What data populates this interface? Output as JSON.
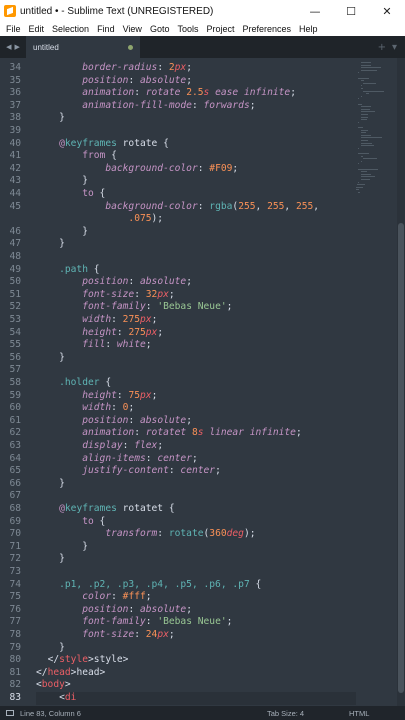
{
  "window": {
    "title": "untitled • - Sublime Text (UNREGISTERED)",
    "minimize_glyph": "—",
    "maximize_glyph": "☐",
    "close_glyph": "✕"
  },
  "menu": [
    "File",
    "Edit",
    "Selection",
    "Find",
    "View",
    "Goto",
    "Tools",
    "Project",
    "Preferences",
    "Help"
  ],
  "tab": {
    "label": "untitled",
    "nav_left": "◀",
    "nav_right": "▶",
    "add": "+",
    "dropdown": "▾"
  },
  "status": {
    "position": "Line 83, Column 6",
    "tab_size": "Tab Size: 4",
    "syntax": "HTML"
  },
  "colors": {
    "bg": "#303841",
    "tabbar": "#1f2429",
    "status": "#20252b",
    "accent": "#8ea56e"
  },
  "active_line": 83,
  "code": [
    {
      "n": 34,
      "i": 8,
      "t": [
        [
          "prop",
          "border-radius"
        ],
        [
          "punct",
          ": "
        ],
        [
          "num",
          "2"
        ],
        [
          "unit",
          "px"
        ],
        [
          "punct",
          ";"
        ]
      ]
    },
    {
      "n": 35,
      "i": 8,
      "t": [
        [
          "prop",
          "position"
        ],
        [
          "punct",
          ": "
        ],
        [
          "val",
          "absolute"
        ],
        [
          "punct",
          ";"
        ]
      ]
    },
    {
      "n": 36,
      "i": 8,
      "t": [
        [
          "prop",
          "animation"
        ],
        [
          "punct",
          ": "
        ],
        [
          "val",
          "rotate "
        ],
        [
          "num",
          "2.5"
        ],
        [
          "unit",
          "s"
        ],
        [
          "val",
          " ease infinite"
        ],
        [
          "punct",
          ";"
        ]
      ]
    },
    {
      "n": 37,
      "i": 8,
      "t": [
        [
          "prop",
          "animation-fill-mode"
        ],
        [
          "punct",
          ": "
        ],
        [
          "val",
          "forwards"
        ],
        [
          "punct",
          ";"
        ]
      ]
    },
    {
      "n": 38,
      "i": 4,
      "t": [
        [
          "punct",
          "}"
        ]
      ]
    },
    {
      "n": 39,
      "i": 0,
      "t": []
    },
    {
      "n": 40,
      "i": 4,
      "t": [
        [
          "at",
          "@"
        ],
        [
          "kw",
          "keyframes"
        ],
        [
          "txt",
          " rotate "
        ],
        [
          "punct",
          "{"
        ]
      ]
    },
    {
      "n": 41,
      "i": 8,
      "t": [
        [
          "at",
          "from"
        ],
        [
          "punct",
          " {"
        ]
      ]
    },
    {
      "n": 42,
      "i": 12,
      "t": [
        [
          "prop",
          "background-color"
        ],
        [
          "punct",
          ": "
        ],
        [
          "hex",
          "#F09"
        ],
        [
          "punct",
          ";"
        ]
      ]
    },
    {
      "n": 43,
      "i": 8,
      "t": [
        [
          "punct",
          "}"
        ]
      ]
    },
    {
      "n": 44,
      "i": 8,
      "t": [
        [
          "at",
          "to"
        ],
        [
          "punct",
          " {"
        ]
      ]
    },
    {
      "n": 45,
      "i": 12,
      "t": [
        [
          "prop",
          "background-color"
        ],
        [
          "punct",
          ": "
        ],
        [
          "fn",
          "rgba"
        ],
        [
          "punct",
          "("
        ],
        [
          "num",
          "255"
        ],
        [
          "punct",
          ", "
        ],
        [
          "num",
          "255"
        ],
        [
          "punct",
          ", "
        ],
        [
          "num",
          "255"
        ],
        [
          "punct",
          ","
        ]
      ]
    },
    {
      "n": null,
      "i": 16,
      "t": [
        [
          "num",
          ".075"
        ],
        [
          "punct",
          ");"
        ]
      ]
    },
    {
      "n": 46,
      "i": 8,
      "t": [
        [
          "punct",
          "}"
        ]
      ]
    },
    {
      "n": 47,
      "i": 4,
      "t": [
        [
          "punct",
          "}"
        ]
      ]
    },
    {
      "n": 48,
      "i": 0,
      "t": []
    },
    {
      "n": 49,
      "i": 4,
      "t": [
        [
          "sel",
          ".path"
        ],
        [
          "punct",
          " {"
        ]
      ]
    },
    {
      "n": 50,
      "i": 8,
      "t": [
        [
          "prop",
          "position"
        ],
        [
          "punct",
          ": "
        ],
        [
          "val",
          "absolute"
        ],
        [
          "punct",
          ";"
        ]
      ]
    },
    {
      "n": 51,
      "i": 8,
      "t": [
        [
          "prop",
          "font-size"
        ],
        [
          "punct",
          ": "
        ],
        [
          "num",
          "32"
        ],
        [
          "unit",
          "px"
        ],
        [
          "punct",
          ";"
        ]
      ]
    },
    {
      "n": 52,
      "i": 8,
      "t": [
        [
          "prop",
          "font-family"
        ],
        [
          "punct",
          ": "
        ],
        [
          "str",
          "'Bebas Neue'"
        ],
        [
          "punct",
          ";"
        ]
      ]
    },
    {
      "n": 53,
      "i": 8,
      "t": [
        [
          "prop",
          "width"
        ],
        [
          "punct",
          ": "
        ],
        [
          "num",
          "275"
        ],
        [
          "unit",
          "px"
        ],
        [
          "punct",
          ";"
        ]
      ]
    },
    {
      "n": 54,
      "i": 8,
      "t": [
        [
          "prop",
          "height"
        ],
        [
          "punct",
          ": "
        ],
        [
          "num",
          "275"
        ],
        [
          "unit",
          "px"
        ],
        [
          "punct",
          ";"
        ]
      ]
    },
    {
      "n": 55,
      "i": 8,
      "t": [
        [
          "prop",
          "fill"
        ],
        [
          "punct",
          ": "
        ],
        [
          "val",
          "white"
        ],
        [
          "punct",
          ";"
        ]
      ]
    },
    {
      "n": 56,
      "i": 4,
      "t": [
        [
          "punct",
          "}"
        ]
      ]
    },
    {
      "n": 57,
      "i": 0,
      "t": []
    },
    {
      "n": 58,
      "i": 4,
      "t": [
        [
          "sel",
          ".holder"
        ],
        [
          "punct",
          " {"
        ]
      ]
    },
    {
      "n": 59,
      "i": 8,
      "t": [
        [
          "prop",
          "height"
        ],
        [
          "punct",
          ": "
        ],
        [
          "num",
          "75"
        ],
        [
          "unit",
          "px"
        ],
        [
          "punct",
          ";"
        ]
      ]
    },
    {
      "n": 60,
      "i": 8,
      "t": [
        [
          "prop",
          "width"
        ],
        [
          "punct",
          ": "
        ],
        [
          "num",
          "0"
        ],
        [
          "punct",
          ";"
        ]
      ]
    },
    {
      "n": 61,
      "i": 8,
      "t": [
        [
          "prop",
          "position"
        ],
        [
          "punct",
          ": "
        ],
        [
          "val",
          "absolute"
        ],
        [
          "punct",
          ";"
        ]
      ]
    },
    {
      "n": 62,
      "i": 8,
      "t": [
        [
          "prop",
          "animation"
        ],
        [
          "punct",
          ": "
        ],
        [
          "val",
          "rotatet "
        ],
        [
          "num",
          "8"
        ],
        [
          "unit",
          "s"
        ],
        [
          "val",
          " linear infinite"
        ],
        [
          "punct",
          ";"
        ]
      ]
    },
    {
      "n": 63,
      "i": 8,
      "t": [
        [
          "prop",
          "display"
        ],
        [
          "punct",
          ": "
        ],
        [
          "val",
          "flex"
        ],
        [
          "punct",
          ";"
        ]
      ]
    },
    {
      "n": 64,
      "i": 8,
      "t": [
        [
          "prop",
          "align-items"
        ],
        [
          "punct",
          ": "
        ],
        [
          "val",
          "center"
        ],
        [
          "punct",
          ";"
        ]
      ]
    },
    {
      "n": 65,
      "i": 8,
      "t": [
        [
          "prop",
          "justify-content"
        ],
        [
          "punct",
          ": "
        ],
        [
          "val",
          "center"
        ],
        [
          "punct",
          ";"
        ]
      ]
    },
    {
      "n": 66,
      "i": 4,
      "t": [
        [
          "punct",
          "}"
        ]
      ]
    },
    {
      "n": 67,
      "i": 0,
      "t": []
    },
    {
      "n": 68,
      "i": 4,
      "t": [
        [
          "at",
          "@"
        ],
        [
          "kw",
          "keyframes"
        ],
        [
          "txt",
          " rotatet "
        ],
        [
          "punct",
          "{"
        ]
      ]
    },
    {
      "n": 69,
      "i": 8,
      "t": [
        [
          "at",
          "to"
        ],
        [
          "punct",
          " {"
        ]
      ]
    },
    {
      "n": 70,
      "i": 12,
      "t": [
        [
          "prop",
          "transform"
        ],
        [
          "punct",
          ": "
        ],
        [
          "fn",
          "rotate"
        ],
        [
          "punct",
          "("
        ],
        [
          "num",
          "360"
        ],
        [
          "unit",
          "deg"
        ],
        [
          "punct",
          ");"
        ]
      ]
    },
    {
      "n": 71,
      "i": 8,
      "t": [
        [
          "punct",
          "}"
        ]
      ]
    },
    {
      "n": 72,
      "i": 4,
      "t": [
        [
          "punct",
          "}"
        ]
      ]
    },
    {
      "n": 73,
      "i": 0,
      "t": []
    },
    {
      "n": 74,
      "i": 4,
      "t": [
        [
          "sel",
          ".p1, .p2, .p3, .p4, .p5, .p6, .p7"
        ],
        [
          "punct",
          " {"
        ]
      ]
    },
    {
      "n": 75,
      "i": 8,
      "t": [
        [
          "prop",
          "color"
        ],
        [
          "punct",
          ": "
        ],
        [
          "hex",
          "#fff"
        ],
        [
          "punct",
          ";"
        ]
      ]
    },
    {
      "n": 76,
      "i": 8,
      "t": [
        [
          "prop",
          "position"
        ],
        [
          "punct",
          ": "
        ],
        [
          "val",
          "absolute"
        ],
        [
          "punct",
          ";"
        ]
      ]
    },
    {
      "n": 77,
      "i": 8,
      "t": [
        [
          "prop",
          "font-family"
        ],
        [
          "punct",
          ": "
        ],
        [
          "str",
          "'Bebas Neue'"
        ],
        [
          "punct",
          ";"
        ]
      ]
    },
    {
      "n": 78,
      "i": 8,
      "t": [
        [
          "prop",
          "font-size"
        ],
        [
          "punct",
          ": "
        ],
        [
          "num",
          "24"
        ],
        [
          "unit",
          "px"
        ],
        [
          "punct",
          ";"
        ]
      ]
    },
    {
      "n": 79,
      "i": 4,
      "t": [
        [
          "punct",
          "}"
        ]
      ]
    },
    {
      "n": 80,
      "i": 2,
      "t": [
        [
          "punct",
          "</"
        ],
        [
          "tag",
          "style"
        ],
        [
          "punct",
          ">"
        ],
        [
          "txt",
          "style>"
        ]
      ]
    },
    {
      "n": 81,
      "i": 0,
      "t": [
        [
          "punct",
          "</"
        ],
        [
          "tag",
          "head"
        ],
        [
          "punct",
          ">"
        ],
        [
          "txt",
          "head>"
        ]
      ]
    },
    {
      "n": 82,
      "i": 0,
      "t": [
        [
          "punct",
          "<"
        ],
        [
          "tag",
          "body"
        ],
        [
          "punct",
          ">"
        ]
      ]
    },
    {
      "n": 83,
      "i": 4,
      "t": [
        [
          "punct",
          "<"
        ],
        [
          "tag",
          "di"
        ]
      ]
    }
  ]
}
